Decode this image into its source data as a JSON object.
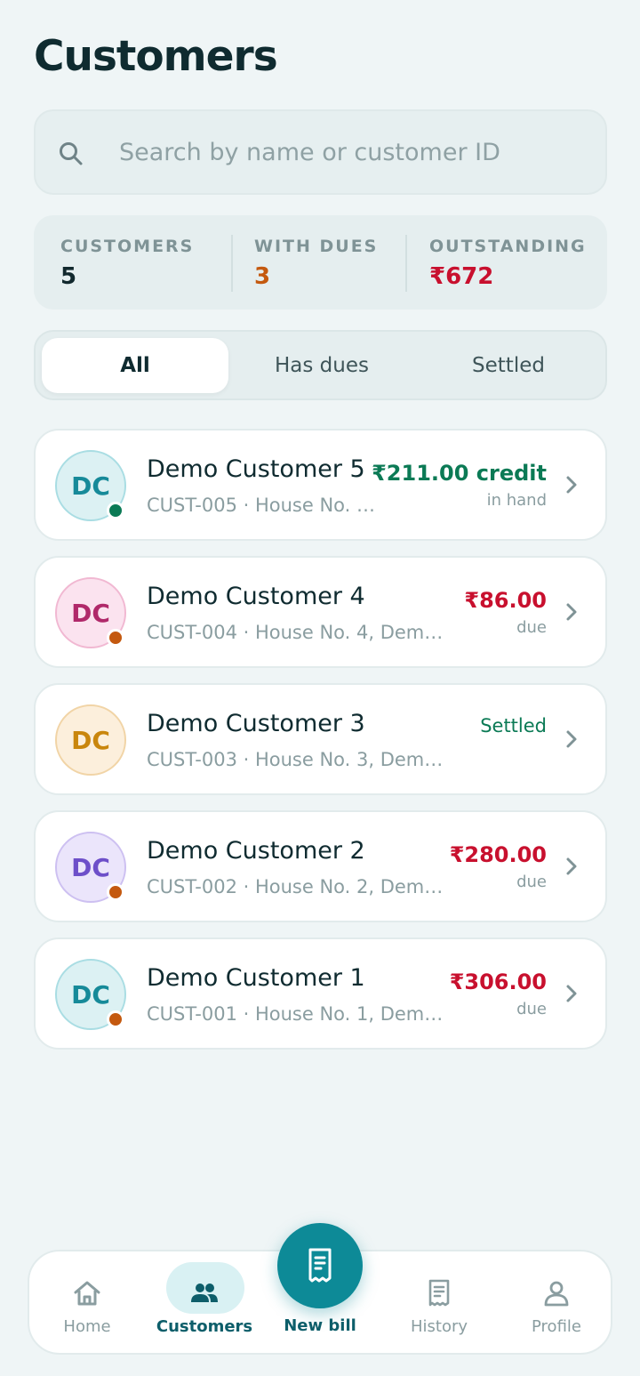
{
  "header": {
    "title": "Customers"
  },
  "search": {
    "placeholder": "Search by name or customer ID",
    "icon": "search-icon"
  },
  "stats": [
    {
      "label": "CUSTOMERS",
      "value": "5",
      "color": "#11282d"
    },
    {
      "label": "WITH DUES",
      "value": "3",
      "color": "#c4590f"
    },
    {
      "label": "OUTSTANDING",
      "value": "₹672",
      "color": "#c8102e"
    }
  ],
  "tabs": [
    {
      "label": "All",
      "active": true
    },
    {
      "label": "Has dues",
      "active": false
    },
    {
      "label": "Settled",
      "active": false
    }
  ],
  "customers": [
    {
      "initials": "DC",
      "name": "Demo Customer 5",
      "id": "CUST-005",
      "address": "House No. …",
      "amount": "₹211.00 credit",
      "note": "in hand",
      "status": "credit",
      "amount_color": "#0b7a55",
      "avatar_bg": "#dcf1f3",
      "avatar_fg": "#168a99",
      "avatar_border": "#a9dde3",
      "dot_color": "#0b7a55"
    },
    {
      "initials": "DC",
      "name": "Demo Customer 4",
      "id": "CUST-004",
      "address": "House No. 4, Dem…",
      "amount": "₹86.00",
      "note": "due",
      "status": "due",
      "amount_color": "#c8102e",
      "avatar_bg": "#fbe3ef",
      "avatar_fg": "#b0296a",
      "avatar_border": "#f1b8d2",
      "dot_color": "#c4590f"
    },
    {
      "initials": "DC",
      "name": "Demo Customer 3",
      "id": "CUST-003",
      "address": "House No. 3, Demo …",
      "amount": "Settled",
      "note": "",
      "status": "settled",
      "amount_color": "#0b7a55",
      "avatar_bg": "#fcefdc",
      "avatar_fg": "#c9860d",
      "avatar_border": "#f1d4a6",
      "dot_color": ""
    },
    {
      "initials": "DC",
      "name": "Demo Customer 2",
      "id": "CUST-002",
      "address": "House No. 2, Dem…",
      "amount": "₹280.00",
      "note": "due",
      "status": "due",
      "amount_color": "#c8102e",
      "avatar_bg": "#ebe5fb",
      "avatar_fg": "#6d4fc9",
      "avatar_border": "#cdc0f1",
      "dot_color": "#c4590f"
    },
    {
      "initials": "DC",
      "name": "Demo Customer 1",
      "id": "CUST-001",
      "address": "House No. 1, Dem…",
      "amount": "₹306.00",
      "note": "due",
      "status": "due",
      "amount_color": "#c8102e",
      "avatar_bg": "#dcf1f3",
      "avatar_fg": "#168a99",
      "avatar_border": "#a9dde3",
      "dot_color": "#c4590f"
    }
  ],
  "nav": {
    "items": [
      {
        "label": "Home",
        "icon": "home-icon",
        "active": false
      },
      {
        "label": "Customers",
        "icon": "users-icon",
        "active": true
      },
      {
        "label": "History",
        "icon": "receipt-icon",
        "active": false
      },
      {
        "label": "Profile",
        "icon": "profile-icon",
        "active": false
      }
    ],
    "fab": {
      "label": "New bill",
      "icon": "new-bill-icon"
    }
  }
}
